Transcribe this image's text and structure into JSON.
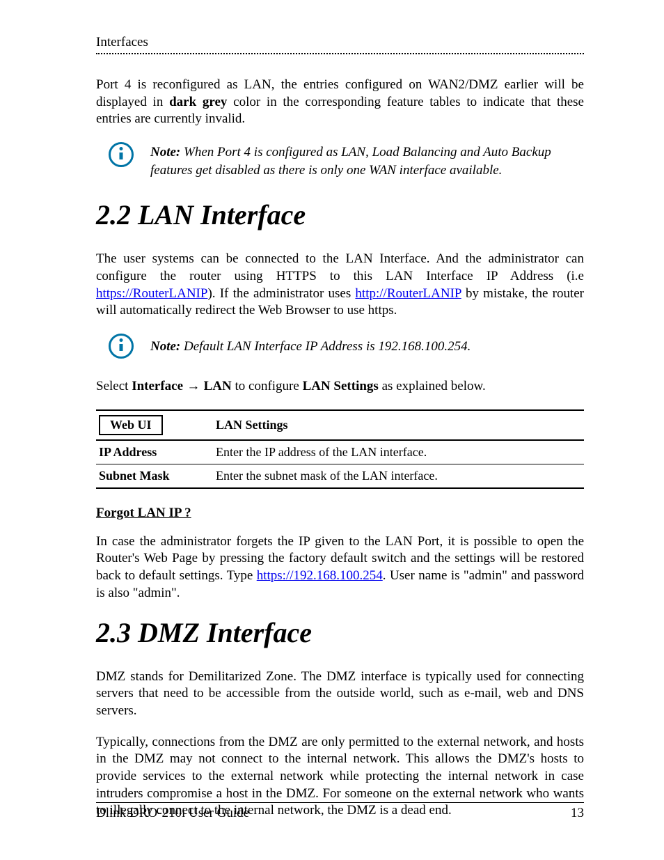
{
  "header": {
    "title": "Interfaces"
  },
  "intro_para_pre": "Port 4 is reconfigured as LAN, the entries configured on WAN2/DMZ earlier will be displayed in ",
  "intro_para_bold": "dark grey",
  "intro_para_post": " color in the corresponding feature tables to indicate that these entries are currently invalid.",
  "note1": {
    "label": "Note:",
    "text": " When Port 4 is configured as LAN, Load Balancing and Auto Backup features get disabled as there is only one WAN interface available."
  },
  "section22": {
    "heading": "2.2 LAN Interface",
    "p1_a": "The user systems can be connected to the LAN Interface. And the administrator can configure the router using HTTPS to this LAN Interface IP Address (i.e ",
    "p1_link1": "https://RouterLANIP",
    "p1_b": "). If the administrator uses ",
    "p1_link2": "http://RouterLANIP",
    "p1_c": " by mistake, the router will automatically redirect the Web Browser to use https.",
    "note2": {
      "label": "Note:",
      "text": "  Default LAN Interface IP Address is 192.168.100.254."
    },
    "nav_a": "Select ",
    "nav_b": "Interface",
    "nav_arrow": " → ",
    "nav_c": "LAN",
    "nav_d": " to configure ",
    "nav_e": "LAN Settings",
    "nav_f": " as explained below.",
    "table": {
      "col1_header": "Web UI",
      "col2_header": "LAN Settings",
      "rows": [
        {
          "label": "IP Address",
          "desc": "Enter the IP address of the LAN interface."
        },
        {
          "label": "Subnet Mask",
          "desc": "Enter the subnet mask of the LAN interface."
        }
      ]
    },
    "forgot": {
      "heading": "Forgot LAN IP ?",
      "p_a": "In case the administrator forgets the IP given to the LAN Port, it is possible to open the Router's Web Page by pressing the factory default switch and the settings will be restored back to default settings. Type ",
      "p_link": "https://192.168.100.254",
      "p_b": ". User name is \"admin\" and password is also \"admin\"."
    }
  },
  "section23": {
    "heading": "2.3 DMZ Interface",
    "p1": "DMZ stands for Demilitarized Zone. The DMZ interface is typically used for connecting servers that need to be accessible from the outside world, such as e-mail, web and DNS servers.",
    "p2": "Typically, connections from the DMZ are only permitted to the external network, and hosts in the DMZ may not connect to the internal network. This allows the DMZ's hosts to provide services to the external network while protecting the internal network in case intruders compromise a host in the DMZ. For someone on the external network who wants to illegally connect to the internal network, the DMZ is a dead end."
  },
  "footer": {
    "left": "Dlink DRO-210i User Guide",
    "right": "13"
  }
}
